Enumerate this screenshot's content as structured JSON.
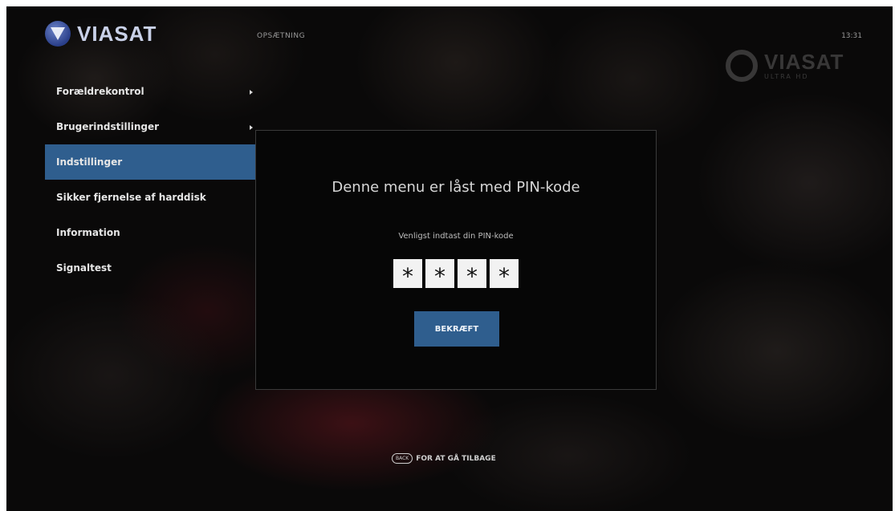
{
  "header": {
    "logo_text": "VIASAT",
    "title": "OPSÆTNING",
    "clock": "13:31",
    "watermark_main": "VIASAT",
    "watermark_sub": "ULTRA HD"
  },
  "menu": {
    "items": [
      {
        "label": "Forældrekontrol",
        "has_arrow": true,
        "selected": false
      },
      {
        "label": "Brugerindstillinger",
        "has_arrow": true,
        "selected": false
      },
      {
        "label": "Indstillinger",
        "has_arrow": false,
        "selected": true
      },
      {
        "label": "Sikker fjernelse af harddisk",
        "has_arrow": false,
        "selected": false
      },
      {
        "label": "Information",
        "has_arrow": false,
        "selected": false
      },
      {
        "label": "Signaltest",
        "has_arrow": false,
        "selected": false
      }
    ]
  },
  "dialog": {
    "title": "Denne menu er låst med PIN-kode",
    "prompt": "Venligst indtast din PIN-kode",
    "pin": [
      "*",
      "*",
      "*",
      "*"
    ],
    "confirm_label": "BEKRÆFT"
  },
  "footer": {
    "key_label": "BACK",
    "hint": "FOR AT GÅ TILBAGE"
  },
  "colors": {
    "accent": "#2f5e8e",
    "background": "#070707"
  }
}
